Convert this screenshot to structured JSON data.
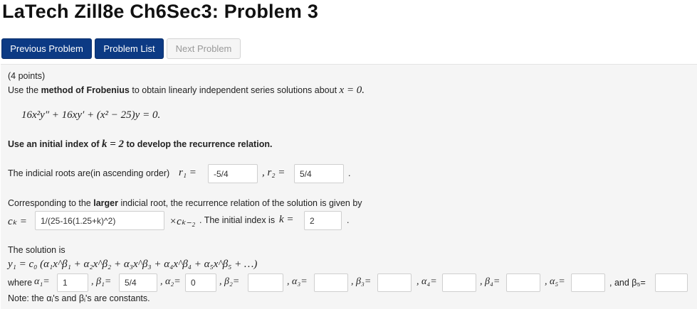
{
  "title": "LaTech Zill8e Ch6Sec3: Problem 3",
  "nav": {
    "previous": "Previous Problem",
    "list": "Problem List",
    "next": "Next Problem"
  },
  "problem": {
    "points": "(4 points)",
    "instr_pre": "Use the ",
    "instr_bold": "method of Frobenius",
    "instr_post": " to obtain linearly independent series solutions about ",
    "instr_math": "x = 0.",
    "equation": "16x²y″ + 16xy′ + (x² − 25)y = 0.",
    "index_pre": "Use an initial index of ",
    "index_math": "k = 2",
    "index_post": " to develop the recurrence relation.",
    "roots_label": "The indicial roots are(in ascending order) ",
    "r1_label": "r₁ =",
    "r1_value": "-5/4",
    "r2_label": ", r₂ =",
    "r2_value": "5/4",
    "roots_end": ".",
    "rec_pre": "Corresponding to the ",
    "rec_bold": "larger",
    "rec_post": " indicial root, the recurrence relation of the solution is given by",
    "ck_label": "cₖ =",
    "ck_value": "1/(25-16(1.25+k)^2)",
    "ck_times": "×cₖ₋₂",
    "init_text": ". The initial index is ",
    "k_label": "k =",
    "k_value": "2",
    "k_end": ".",
    "solution_label": "The solution is",
    "solution_formula": "y₁ = c₀ (α₁x^β₁ + α₂x^β₂ + α₃x^β₃ + α₄x^β₄ + α₅x^β₅ + …)",
    "where": "where",
    "a1_label": "α₁=",
    "a1_value": "1",
    "b1_label": ", β₁=",
    "b1_value": "5/4",
    "a2_label": ", α₂=",
    "a2_value": "0",
    "b2_label": ", β₂=",
    "b2_value": "",
    "a3_label": ", α₃=",
    "a3_value": "",
    "b3_label": ", β₃=",
    "b3_value": "",
    "a4_label": ", α₄=",
    "a4_value": "",
    "b4_label": ", β₄=",
    "b4_value": "",
    "a5_label": ", α₅=",
    "a5_value": "",
    "b5_label": ", and β₅=",
    "b5_value": "",
    "note": "Note: the αᵢ's and βᵢ's are constants."
  }
}
